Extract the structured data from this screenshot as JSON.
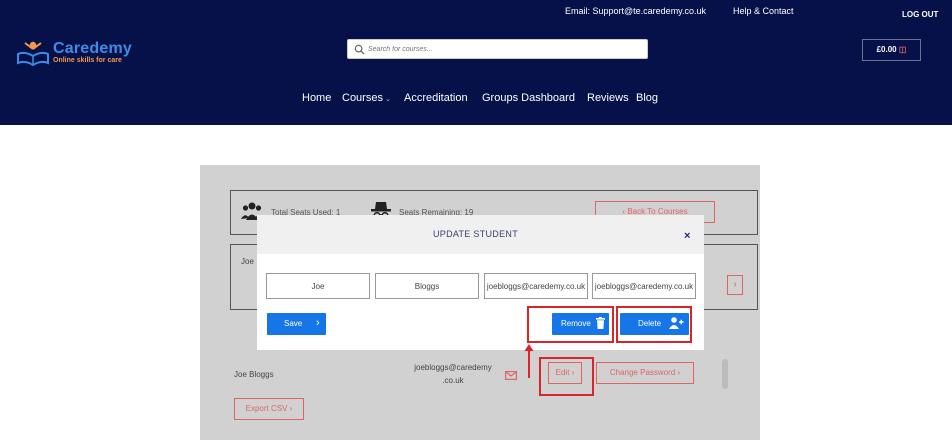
{
  "topbar": {
    "email": "Email: Support@te.caredemy.co.uk",
    "help": "Help & Contact",
    "logout": "LOG OUT"
  },
  "brand": {
    "name": "Caredemy",
    "tagline": "Online skills for care",
    "name_color": "#3c8ce7",
    "tagline_color": "#f2994a"
  },
  "search": {
    "placeholder": "Search for courses..."
  },
  "cart": {
    "total": "£0.00"
  },
  "nav": [
    {
      "label": "Home"
    },
    {
      "label": "Courses"
    },
    {
      "label": "Accreditation"
    },
    {
      "label": "Groups Dashboard"
    },
    {
      "label": "Reviews"
    },
    {
      "label": "Blog"
    }
  ],
  "dashboard": {
    "seats_used": "Total Seats Used: 1",
    "seats_remaining": "Seats Remaining: 19",
    "back_button": "Back To Courses",
    "row_name": "Joe",
    "student": {
      "name": "Joe Bloggs",
      "email_line1": "joebloggs@caredemy",
      "email_line2": ".co.uk"
    },
    "edit_label": "Edit",
    "change_password_label": "Change Password",
    "export_label": "Export CSV"
  },
  "modal": {
    "title": "UPDATE STUDENT",
    "close": "×",
    "fields": {
      "first_name": "Joe",
      "last_name": "Bloggs",
      "email": "joebloggs@caredemy.co.uk",
      "confirm_email": "joebloggs@caredemy.co.uk"
    },
    "save_label": "Save",
    "remove_label": "Remove",
    "delete_label": "Delete"
  },
  "colors": {
    "header_bg": "#06114a",
    "primary_button": "#1676e8",
    "outline_button": "#e06464",
    "highlight": "#d9252a"
  }
}
